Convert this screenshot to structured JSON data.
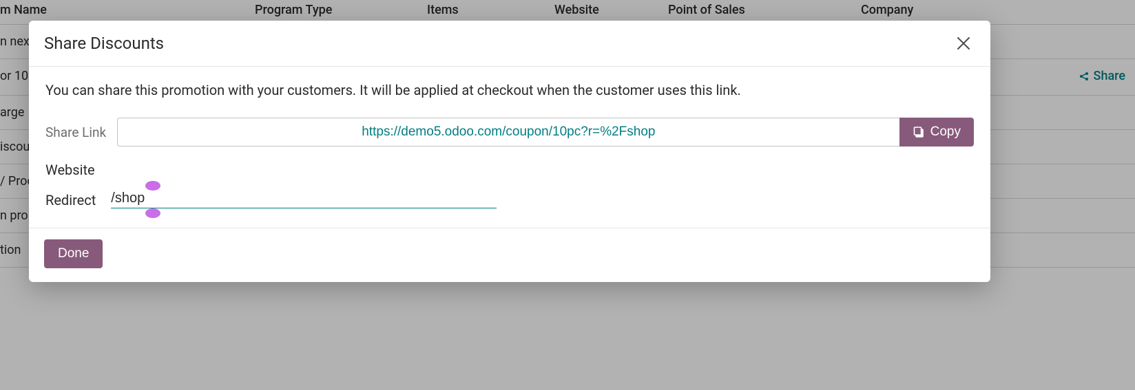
{
  "bg": {
    "headers": {
      "name": "m Name",
      "type": "Program Type",
      "items": "Items",
      "website": "Website",
      "pos": "Point of Sales",
      "company": "Company"
    },
    "rows": [
      "n nex",
      "or 10",
      "arge",
      "iscou",
      "/ Proc",
      "n pro",
      "tion"
    ],
    "share_label": "Share"
  },
  "modal": {
    "title": "Share Discounts",
    "intro": "You can share this promotion with your customers. It will be applied at checkout when the customer uses this link.",
    "share_link_label": "Share Link",
    "share_link_value": "https://demo5.odoo.com/coupon/10pc?r=%2Fshop",
    "copy_label": "Copy",
    "website_label": "Website",
    "redirect_label": "Redirect",
    "redirect_value": "/shop",
    "done_label": "Done"
  }
}
